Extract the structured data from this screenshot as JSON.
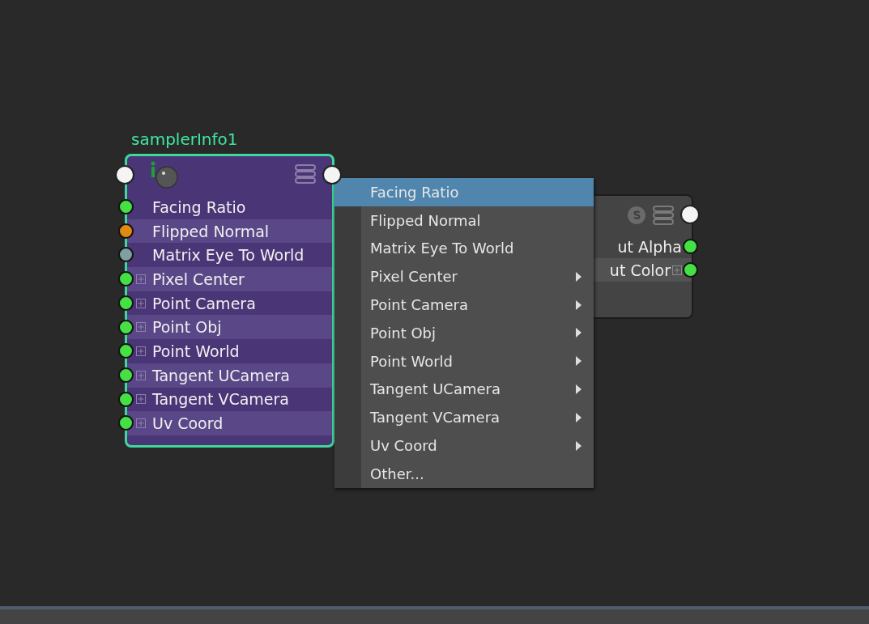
{
  "sampler_node": {
    "title": "samplerInfo1",
    "attributes": [
      {
        "label": "Facing Ratio",
        "color": "#44e044",
        "expandable": false
      },
      {
        "label": "Flipped Normal",
        "color": "#e08a10",
        "expandable": false
      },
      {
        "label": "Matrix Eye To World",
        "color": "#7f9fa0",
        "expandable": false
      },
      {
        "label": "Pixel Center",
        "color": "#44e044",
        "expandable": true
      },
      {
        "label": "Point Camera",
        "color": "#44e044",
        "expandable": true
      },
      {
        "label": "Point Obj",
        "color": "#44e044",
        "expandable": true
      },
      {
        "label": "Point World",
        "color": "#44e044",
        "expandable": true
      },
      {
        "label": "Tangent UCamera",
        "color": "#44e044",
        "expandable": true
      },
      {
        "label": "Tangent VCamera",
        "color": "#44e044",
        "expandable": true
      },
      {
        "label": "Uv Coord",
        "color": "#44e044",
        "expandable": true
      }
    ]
  },
  "ramp_node": {
    "outputs": [
      {
        "label": "ut Alpha",
        "color": "#44e044",
        "expandable": false
      },
      {
        "label": "ut Color",
        "color": "#44e044",
        "expandable": true
      }
    ]
  },
  "context_menu": {
    "items": [
      {
        "label": "Facing Ratio",
        "selected": true,
        "submenu": false
      },
      {
        "label": "Flipped Normal",
        "selected": false,
        "submenu": false
      },
      {
        "label": "Matrix Eye To World",
        "selected": false,
        "submenu": false
      },
      {
        "label": "Pixel Center",
        "selected": false,
        "submenu": true
      },
      {
        "label": "Point Camera",
        "selected": false,
        "submenu": true
      },
      {
        "label": "Point Obj",
        "selected": false,
        "submenu": true
      },
      {
        "label": "Point World",
        "selected": false,
        "submenu": true
      },
      {
        "label": "Tangent UCamera",
        "selected": false,
        "submenu": true
      },
      {
        "label": "Tangent VCamera",
        "selected": false,
        "submenu": true
      },
      {
        "label": "Uv Coord",
        "selected": false,
        "submenu": true
      },
      {
        "label": "Other...",
        "selected": false,
        "submenu": false
      }
    ]
  }
}
